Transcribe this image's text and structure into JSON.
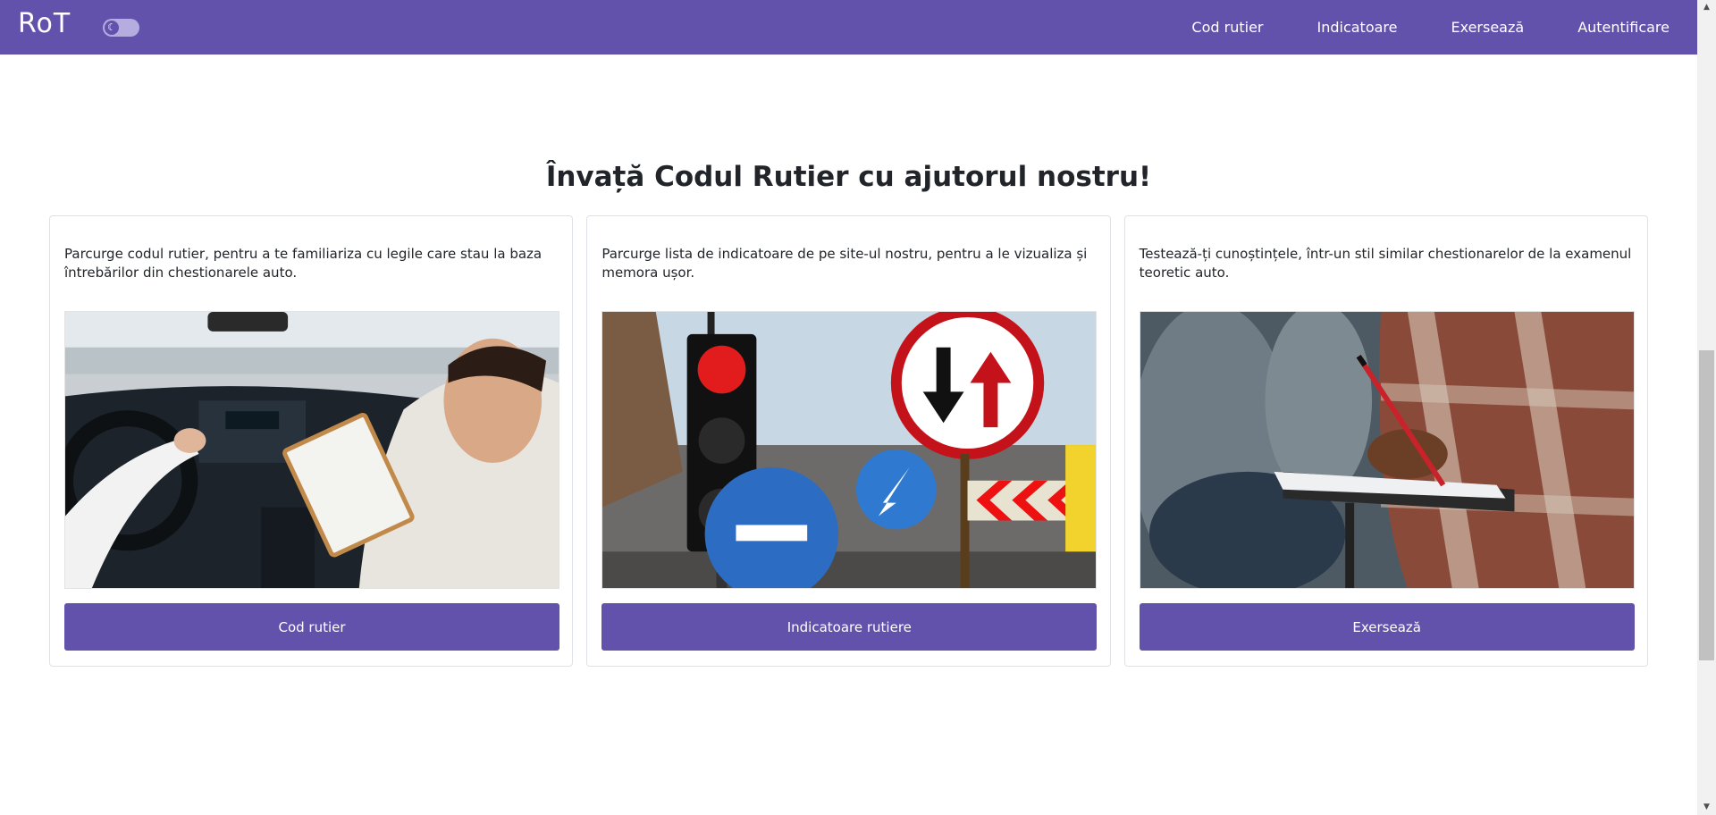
{
  "navbar": {
    "brand": "RoT",
    "links": [
      "Cod rutier",
      "Indicatoare",
      "Exersează",
      "Autentificare"
    ],
    "color": "#6352ac"
  },
  "main": {
    "headline": "Învață Codul Rutier cu ajutorul nostru!",
    "cards": [
      {
        "text": "Parcurge codul rutier, pentru a te familiariza cu legile care stau la baza întrebărilor din chestionarele auto.",
        "button": "Cod rutier",
        "image": "driving-lesson-photo"
      },
      {
        "text": "Parcurge lista de indicatoare de pe site-ul nostru, pentru a le vizualiza și memora ușor.",
        "button": "Indicatoare rutiere",
        "image": "traffic-signs-photo"
      },
      {
        "text": "Testează-ți cunoștințele, într-un stil similar chestionarelor de la examenul teoretic auto.",
        "button": "Exersează",
        "image": "exam-writing-photo"
      }
    ]
  }
}
